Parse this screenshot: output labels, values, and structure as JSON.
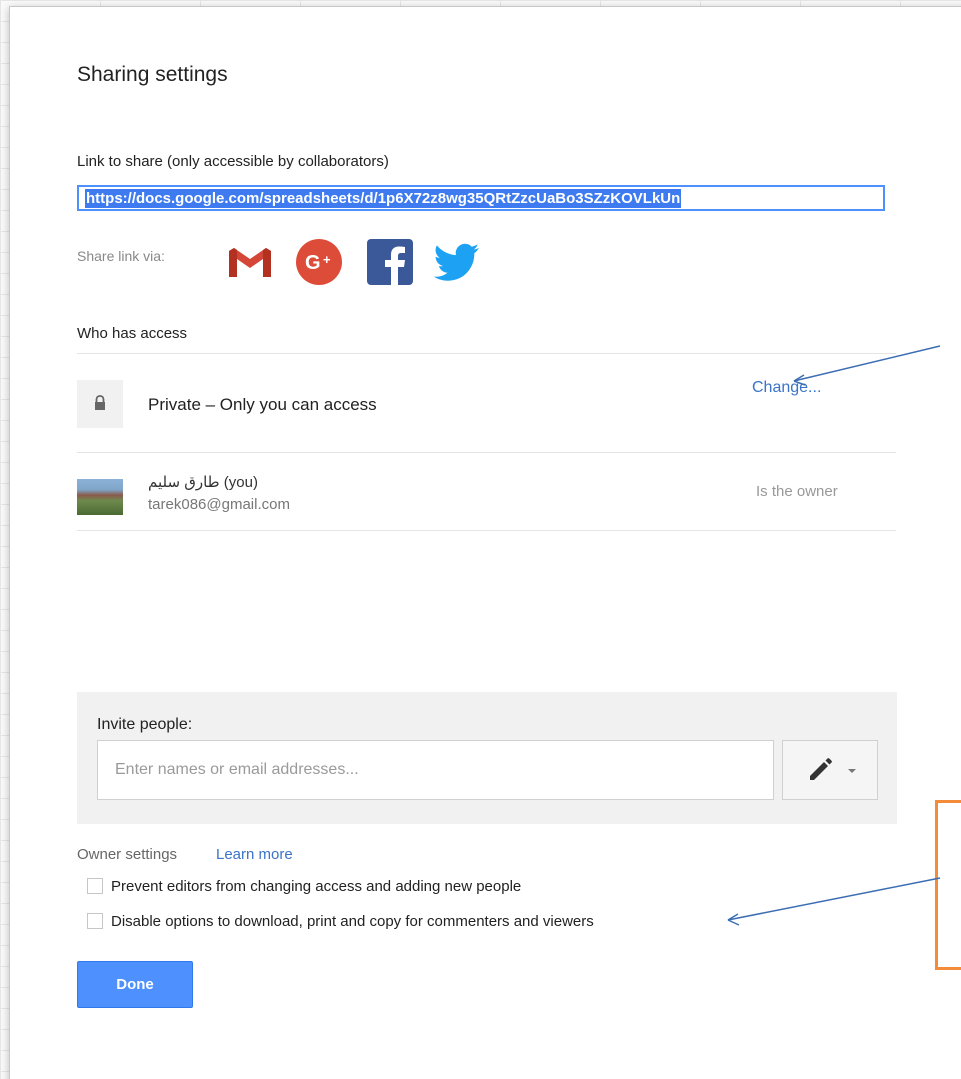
{
  "dialog": {
    "title": "Sharing settings"
  },
  "link": {
    "label": "Link to share (only accessible by collaborators)",
    "url": "https://docs.google.com/spreadsheets/d/1p6X72z8wg35QRtZzcUaBo3SZzKOVLkUn"
  },
  "share_via": {
    "label": "Share link via:",
    "icons": [
      "gmail-icon",
      "google-plus-icon",
      "facebook-icon",
      "twitter-icon"
    ],
    "colors": {
      "gmail": "#d44638",
      "google_plus": "#dd4b39",
      "facebook": "#3b5998",
      "twitter": "#1da1f2"
    }
  },
  "access": {
    "label": "Who has access",
    "visibility": {
      "icon": "lock-icon",
      "text": "Private – Only you can access",
      "change_label": "Change..."
    },
    "owner": {
      "name": "طارق سليم (you)",
      "email": "tarek086@gmail.com",
      "role": "Is the owner"
    }
  },
  "invite": {
    "label": "Invite people:",
    "placeholder": "Enter names or email addresses...",
    "permission_icon": "pencil-icon"
  },
  "owner_settings": {
    "label": "Owner settings",
    "learn_more": "Learn more",
    "options": [
      {
        "label": "Prevent editors from changing access and adding new people",
        "checked": false
      },
      {
        "label": "Disable options to download, print and copy for commenters and viewers",
        "checked": false
      }
    ]
  },
  "actions": {
    "done_label": "Done"
  },
  "colors": {
    "accent": "#4d90fe",
    "link": "#3b73c8",
    "annotation_box": "#f28c3a",
    "annotation_arrow": "#3b6db3"
  }
}
